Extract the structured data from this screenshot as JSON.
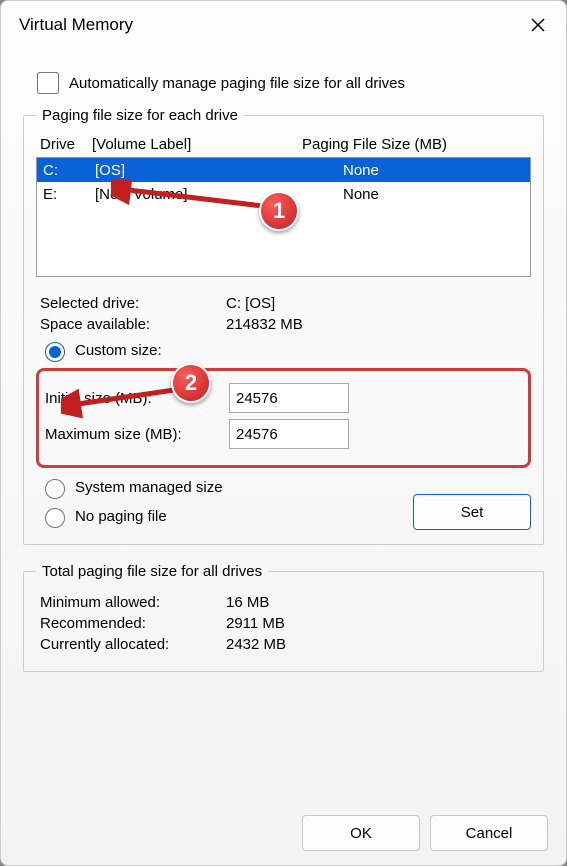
{
  "title": "Virtual Memory",
  "auto_manage_label": "Automatically manage paging file size for all drives",
  "auto_manage_checked": false,
  "group1_title": "Paging file size for each drive",
  "drive_header": {
    "drive": "Drive",
    "label": "[Volume Label]",
    "size": "Paging File Size (MB)"
  },
  "drives": [
    {
      "drive": "C:",
      "label": "[OS]",
      "size": "None",
      "selected": true
    },
    {
      "drive": "E:",
      "label": "[New Volume]",
      "size": "None",
      "selected": false
    }
  ],
  "selected_drive_label": "Selected drive:",
  "selected_drive_value": "C:  [OS]",
  "space_label": "Space available:",
  "space_value": "214832 MB",
  "opt_custom": "Custom size:",
  "opt_system": "System managed size",
  "opt_none": "No paging file",
  "initial_label": "Initial size (MB):",
  "initial_value": "24576",
  "max_label": "Maximum size (MB):",
  "max_value": "24576",
  "set_btn": "Set",
  "group2_title": "Total paging file size for all drives",
  "min_label": "Minimum allowed:",
  "min_value": "16 MB",
  "rec_label": "Recommended:",
  "rec_value": "2911 MB",
  "cur_label": "Currently allocated:",
  "cur_value": "2432 MB",
  "ok_btn": "OK",
  "cancel_btn": "Cancel",
  "markers": {
    "m1": "1",
    "m2": "2"
  }
}
